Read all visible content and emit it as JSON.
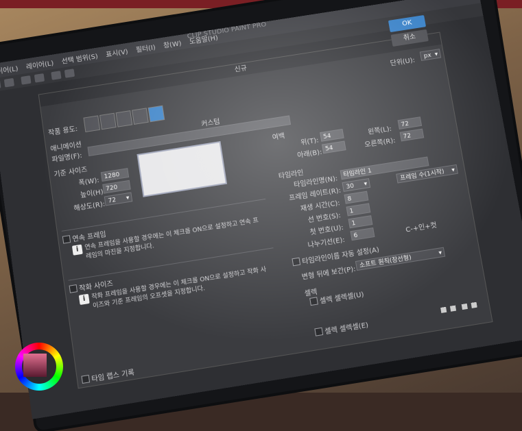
{
  "app": {
    "title": "CLIP STUDIO PAINT PRO",
    "menus": [
      "이어(L)",
      "레이어(L)",
      "선택 범위(S)",
      "표시(V)",
      "필터(I)",
      "창(W)",
      "도움말(H)"
    ]
  },
  "dialog": {
    "title": "신규",
    "ok_label": "OK",
    "cancel_label": "취소",
    "unit_label": "단위(U):",
    "unit_value": "px",
    "work_type_label": "작품 용도:",
    "preset_label": "애니메이션",
    "file_name_label": "파일명(F):",
    "custom_label": "커스텀",
    "base_size_label": "기준 사이즈",
    "width_label": "폭(W):",
    "width_value": "1280",
    "height_label": "높이(H):",
    "height_value": "720",
    "resolution_label": "해상도(R):",
    "resolution_value": "72",
    "margin_label": "여백",
    "top_label": "위(T):",
    "top_value": "54",
    "bottom_label": "아래(B):",
    "bottom_value": "54",
    "left_label": "왼쪽(L):",
    "left_value": "72",
    "right_label": "오른쪽(R):",
    "right_value": "72",
    "timeline_label": "타임라인",
    "timeline_name_label": "타임라인명(N):",
    "timeline_name_value": "타임라인 1",
    "frame_rate_label": "프레임 레이트(R):",
    "frame_rate_value": "30",
    "playtime_label": "재생 시간(C):",
    "playtime_value": "8",
    "frame_count_select": "프레임 수(1시작)",
    "line_number_label": "선 번호(S):",
    "line_number_value": "1",
    "first_number_label": "첫 번호(U):",
    "first_number_value": "1",
    "separator_label": "나누기선(E):",
    "separator_value": "6",
    "shortcut_text": "C-+인+컷",
    "continuous_frame_label": "연속 프레임",
    "continuous_frame_info": "연속 프레임을 사용할 경우에는 이 체크를 ON으로 설정하고 연속 프레임의 마진을 지정합니다.",
    "auto_timeline_label": "타임라인이름 자동 설정(A)",
    "interp_label": "변형 뒤에 보간(P):",
    "interp_value": "소프트 원칙(장선형)",
    "work_size_label": "작화 사이즈",
    "work_size_info": "작화 프레임을 사용할 경우에는 이 체크를 ON으로 설정하고 작화 사이즈와 기준 프레임의 오프셋을 지정합니다.",
    "cel_label": "셀렉",
    "cel_check_label": "셀렉 셀렉셀(U)",
    "bottom_check_label": "셀렉 셀렉셀(E)",
    "timelapse_label": "타임 랩스 기록"
  },
  "colors": {
    "accent": "#3a82c8",
    "dialog_bg": "#3b3c40",
    "brand_band": "#7a1f24"
  }
}
